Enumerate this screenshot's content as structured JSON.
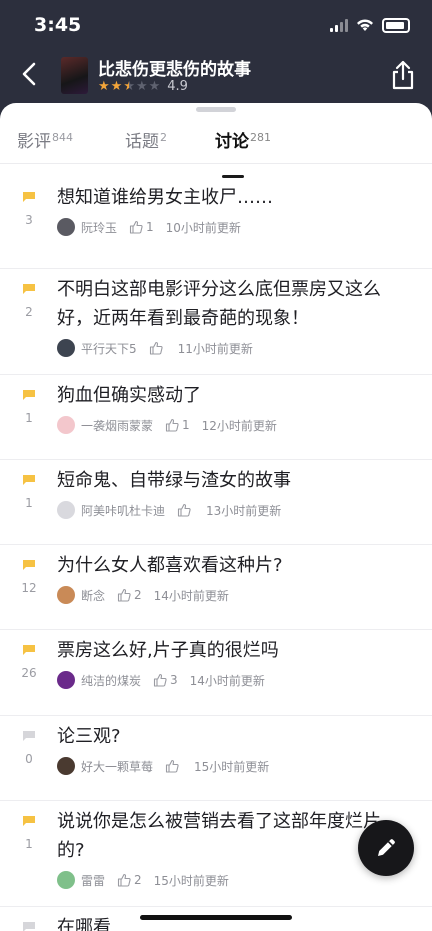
{
  "status_bar": {
    "time": "3:45"
  },
  "movie": {
    "title": "比悲伤更悲伤的故事",
    "rating": "4.9",
    "stars_filled": 2.5,
    "stars_total": 5
  },
  "tabs": [
    {
      "label": "影评",
      "count": "844",
      "active": false
    },
    {
      "label": "话题",
      "count": "2",
      "active": false
    },
    {
      "label": "讨论",
      "count": "281",
      "active": true
    }
  ],
  "posts": [
    {
      "title": "想知道谁给男女主收尸……",
      "replies": "3",
      "user": "阮玲玉",
      "likes": "1",
      "time": "10小时前更新",
      "avatar_color": "#5a5a62",
      "flag": "hot"
    },
    {
      "title": "不明白这部电影评分这么底但票房又这么好，近两年看到最奇葩的现象！",
      "replies": "2",
      "user": "平行天下5",
      "likes": "",
      "time": "11小时前更新",
      "avatar_color": "#3d4450",
      "flag": "hot"
    },
    {
      "title": "狗血但确实感动了",
      "replies": "1",
      "user": "一袭烟雨蒙蒙",
      "likes": "1",
      "time": "12小时前更新",
      "avatar_color": "#f3c7cc",
      "flag": "hot"
    },
    {
      "title": "短命鬼、自带绿与渣女的故事",
      "replies": "1",
      "user": "阿美咔叽杜卡迪",
      "likes": "",
      "time": "13小时前更新",
      "avatar_color": "#d9d9de",
      "flag": "hot"
    },
    {
      "title": "为什么女人都喜欢看这种片?",
      "replies": "12",
      "user": "断念",
      "likes": "2",
      "time": "14小时前更新",
      "avatar_color": "#c98a57",
      "flag": "hot"
    },
    {
      "title": "票房这么好,片子真的很烂吗",
      "replies": "26",
      "user": "纯洁的煤炭",
      "likes": "3",
      "time": "14小时前更新",
      "avatar_color": "#6a2a8a",
      "flag": "hot"
    },
    {
      "title": "论三观?",
      "replies": "0",
      "user": "好大一颗草莓",
      "likes": "",
      "time": "15小时前更新",
      "avatar_color": "#4a3a30",
      "flag": "cold"
    },
    {
      "title": "说说你是怎么被营销去看了这部年度烂片的?",
      "replies": "1",
      "user": "雷雷",
      "likes": "2",
      "time": "15小时前更新",
      "avatar_color": "#7fc08a",
      "flag": "hot"
    },
    {
      "title": "在哪看",
      "replies": "",
      "user": "",
      "likes": "",
      "time": "",
      "avatar_color": "#cccccc",
      "flag": "cold"
    }
  ],
  "colors": {
    "header_bg": "#2c2f3d",
    "accent_star": "#f3a53a",
    "flag_hot": "#f6c243",
    "flag_cold": "#d6d6da",
    "fab_bg": "#17171a"
  },
  "icons": {
    "back": "chevron-left-icon",
    "share": "share-icon",
    "like": "thumbs-up-icon",
    "compose": "pencil-icon",
    "flag": "comment-flag-icon"
  }
}
